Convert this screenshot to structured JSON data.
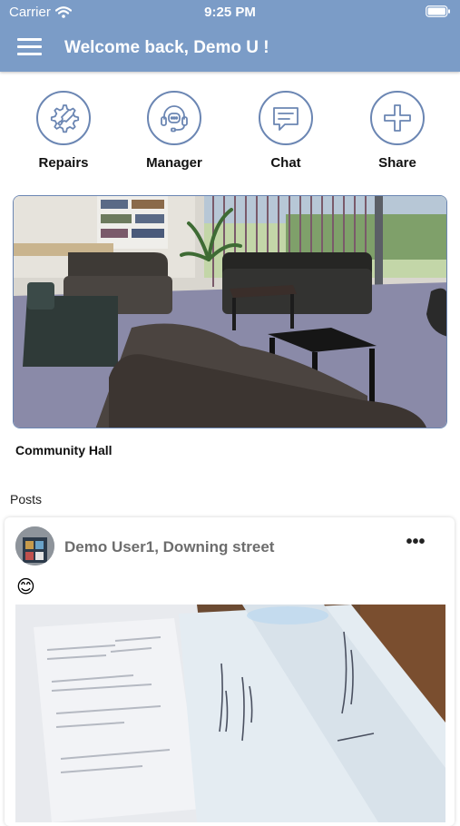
{
  "status_bar": {
    "carrier": "Carrier",
    "time": "9:25 PM"
  },
  "header": {
    "title": "Welcome back, Demo U !"
  },
  "actions": [
    {
      "label": "Repairs",
      "icon": "wrench-gear-icon"
    },
    {
      "label": "Manager",
      "icon": "headset-icon"
    },
    {
      "label": "Chat",
      "icon": "chat-bubble-icon"
    },
    {
      "label": "Share",
      "icon": "plus-icon"
    }
  ],
  "featured": {
    "caption": "Community Hall"
  },
  "posts": {
    "heading": "Posts",
    "items": [
      {
        "author": "Demo User1, Downing street",
        "text": "😊"
      }
    ]
  },
  "colors": {
    "accent": "#7b9cc7",
    "icon_stroke": "#6b86b3"
  }
}
